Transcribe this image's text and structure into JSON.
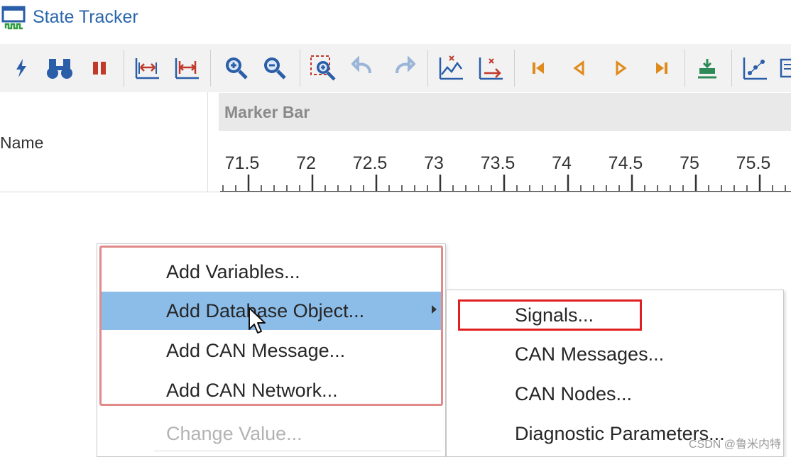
{
  "window": {
    "title": "State Tracker"
  },
  "toolbar": {
    "buttons": [
      {
        "icon": "lightning-icon",
        "color": "#2a5ea8"
      },
      {
        "icon": "binoculars-icon",
        "color": "#2a5ea8"
      },
      {
        "icon": "pause-icon",
        "color": "#c0392b"
      },
      {
        "icon": "fit-horizontal-icon",
        "color": "#2a5ea8"
      },
      {
        "icon": "fit-range-icon",
        "color": "#2a5ea8"
      },
      {
        "icon": "zoom-in-icon",
        "color": "#2a5ea8"
      },
      {
        "icon": "zoom-out-icon",
        "color": "#2a5ea8"
      },
      {
        "icon": "zoom-region-icon",
        "color": "#2a5ea8"
      },
      {
        "icon": "undo-icon",
        "color": "#9bb5d8"
      },
      {
        "icon": "redo-icon",
        "color": "#9bb5d8"
      },
      {
        "icon": "chart-x-icon",
        "color": "#2a5ea8"
      },
      {
        "icon": "chart-export-icon",
        "color": "#2a5ea8"
      },
      {
        "icon": "first-icon",
        "color": "#e08a1c"
      },
      {
        "icon": "previous-icon",
        "color": "#e08a1c"
      },
      {
        "icon": "next-icon",
        "color": "#e08a1c"
      },
      {
        "icon": "last-icon",
        "color": "#e08a1c"
      },
      {
        "icon": "marker-icon",
        "color": "#2e8b57"
      },
      {
        "icon": "scatter-chart-icon",
        "color": "#2a5ea8"
      },
      {
        "icon": "panel-icon",
        "color": "#2a5ea8"
      }
    ]
  },
  "name_column": {
    "label": "Name"
  },
  "marker_bar": {
    "label": "Marker Bar"
  },
  "ruler": {
    "labels": [
      "71.5",
      "72",
      "72.5",
      "73",
      "73.5",
      "74",
      "74.5",
      "75",
      "75.5"
    ]
  },
  "context_menu": {
    "items": [
      {
        "label": "Add Variables...",
        "highlighted": false,
        "enabled": true,
        "submenu": false
      },
      {
        "label": "Add Database Object...",
        "highlighted": true,
        "enabled": true,
        "submenu": true
      },
      {
        "label": "Add CAN Message...",
        "highlighted": false,
        "enabled": true,
        "submenu": false
      },
      {
        "label": "Add CAN Network...",
        "highlighted": false,
        "enabled": true,
        "submenu": false
      },
      {
        "label": "Change Value...",
        "highlighted": false,
        "enabled": false,
        "submenu": false
      }
    ]
  },
  "submenu": {
    "items": [
      {
        "label": "Signals..."
      },
      {
        "label": "CAN Messages..."
      },
      {
        "label": "CAN Nodes..."
      },
      {
        "label": "Diagnostic Parameters..."
      }
    ]
  },
  "annotations": {
    "highlight_color": "#e02020"
  },
  "watermark": "CSDN @鲁米内特"
}
